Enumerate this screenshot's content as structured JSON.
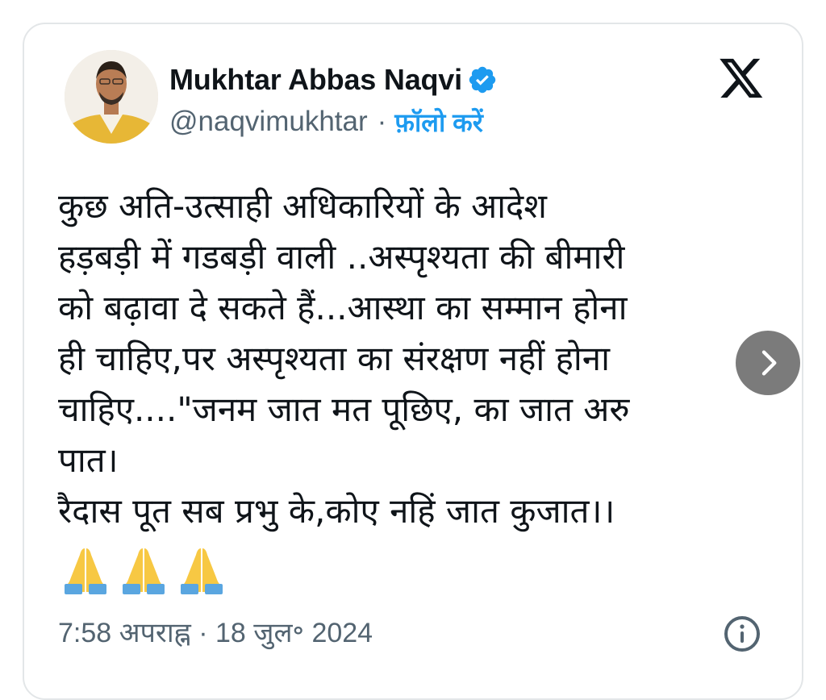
{
  "author": {
    "name": "Mukhtar Abbas Naqvi",
    "handle": "@naqvimukhtar",
    "separator": "·",
    "follow_label": "फ़ॉलो करें",
    "verified_icon": "verified-badge-icon",
    "avatar_icon": "profile-avatar"
  },
  "header": {
    "logo_icon": "x-logo-icon"
  },
  "tweet": {
    "lines": [
      "कुछ अति-उत्साही अधिकारियों के आदेश",
      "हड़बड़ी में गडबड़ी वाली ..अस्पृश्यता की बीमारी",
      "को बढ़ावा दे सकते हैं...आस्था का सम्मान होना",
      "ही चाहिए,पर अस्पृश्यता का संरक्षण नहीं होना",
      "चाहिए....\"जनम जात मत पूछिए, का जात अरु",
      "पात।",
      "रैदास पूत सब प्रभु के,कोए नहिं जात कुजात।।"
    ],
    "emoji": [
      "🙏",
      "🙏",
      "🙏"
    ]
  },
  "footer": {
    "timestamp": "7:58 अपराह्न · 18 जुल॰ 2024",
    "info_icon": "info-icon"
  },
  "navigation": {
    "next_icon": "chevron-right-icon"
  },
  "colors": {
    "text_primary": "#0f1419",
    "text_secondary": "#536471",
    "accent": "#1d9bf0",
    "card_border": "#e3e6e8"
  }
}
